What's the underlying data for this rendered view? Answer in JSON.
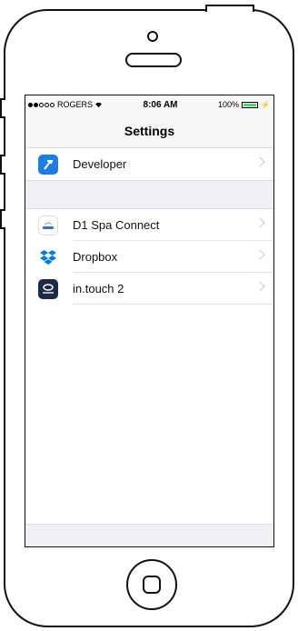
{
  "status_bar": {
    "carrier": "ROGERS",
    "time": "8:06 AM",
    "battery": "100%"
  },
  "nav": {
    "title": "Settings"
  },
  "rows_top": [
    {
      "label": "Developer",
      "icon": "developer-hammer-icon",
      "color": "#1a7fe0"
    }
  ],
  "rows_apps": [
    {
      "label": "D1 Spa Connect",
      "icon": "d1-spa-connect-app-icon",
      "color": "#ffffff"
    },
    {
      "label": "Dropbox",
      "icon": "dropbox-icon",
      "color": "#007ee5"
    },
    {
      "label": "in.touch 2",
      "icon": "intouch2-app-icon",
      "color": "#1f2a44"
    }
  ]
}
